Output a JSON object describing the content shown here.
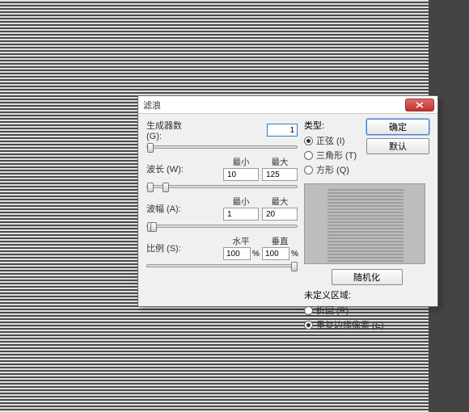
{
  "dialog": {
    "title": "滤浪",
    "generators": {
      "label": "生成器数 (G):",
      "value": "1"
    },
    "wavelength": {
      "label": "波长 (W):",
      "min_hdr": "最小",
      "max_hdr": "最大",
      "min": "10",
      "max": "125"
    },
    "amplitude": {
      "label": "波幅 (A):",
      "min_hdr": "最小",
      "max_hdr": "最大",
      "min": "1",
      "max": "20"
    },
    "scale": {
      "label": "比例 (S):",
      "h_hdr": "水平",
      "v_hdr": "垂直",
      "h": "100",
      "v": "100",
      "unit": "%"
    },
    "type": {
      "title": "类型:",
      "options": [
        {
          "label": "正弦 (I)",
          "checked": true
        },
        {
          "label": "三角形 (T)",
          "checked": false
        },
        {
          "label": "方形 (Q)",
          "checked": false
        }
      ]
    },
    "buttons": {
      "ok": "确定",
      "defaults": "默认",
      "randomize": "随机化"
    },
    "undefined": {
      "title": "未定义区域:",
      "options": [
        {
          "label": "折回 (R)",
          "checked": false
        },
        {
          "label": "重复边缘像素 (E)",
          "checked": true
        }
      ]
    }
  }
}
